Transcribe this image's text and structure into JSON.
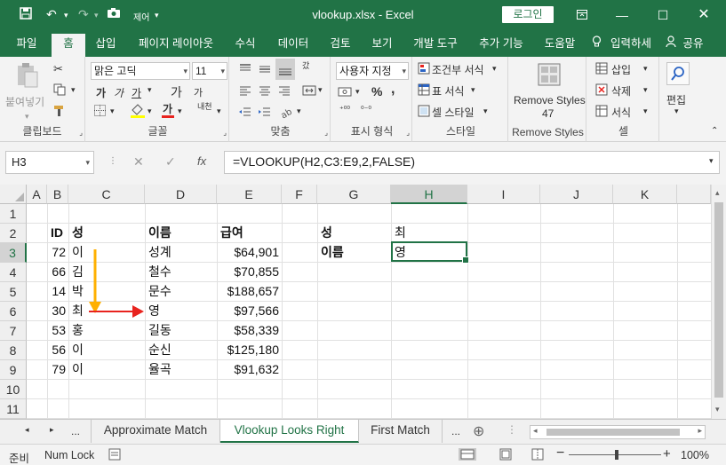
{
  "window": {
    "title": "vlookup.xlsx  -  Excel",
    "login_label": "로그인",
    "autosave_label": "제어"
  },
  "ribbon_tabs": [
    "파일",
    "홈",
    "삽입",
    "페이지 레이아웃",
    "수식",
    "데이터",
    "검토",
    "보기",
    "개발 도구",
    "추가 기능",
    "도움말",
    "입력하세",
    "공유"
  ],
  "ribbon": {
    "clipboard": {
      "paste": "붙여넣기",
      "label": "클립보드"
    },
    "font": {
      "name": "맑은 고딕",
      "size": "11",
      "bold": "가",
      "italic": "가",
      "underline": "가",
      "grow": "가",
      "shrink": "가",
      "label": "글꼴",
      "wrap": "내천"
    },
    "alignment": {
      "label": "맞춤",
      "wrap_text": "갔"
    },
    "number": {
      "format": "사용자 지정",
      "percent": "%",
      "comma": ",",
      "label": "표시 형식"
    },
    "styles": {
      "conditional": "조건부 서식",
      "table": "표 서식",
      "cell": "셀 스타일",
      "label": "스타일"
    },
    "remove_styles": {
      "title": "Remove Styles",
      "count": "47",
      "label": "Remove Styles"
    },
    "cells": {
      "insert": "삽입",
      "delete": "삭제",
      "format": "서식",
      "label": "셀"
    },
    "editing": {
      "label": "편집"
    }
  },
  "formula_bar": {
    "name_box": "H3",
    "fx": "fx",
    "formula": "=VLOOKUP(H2,C3:E9,2,FALSE)"
  },
  "columns": [
    "A",
    "B",
    "C",
    "D",
    "E",
    "F",
    "G",
    "H",
    "I",
    "J",
    "K"
  ],
  "rows": [
    "1",
    "2",
    "3",
    "4",
    "5",
    "6",
    "7",
    "8",
    "9",
    "10",
    "11"
  ],
  "table": {
    "headers": {
      "id": "ID",
      "surname": "성",
      "name": "이름",
      "salary": "급여"
    },
    "rows": [
      {
        "id": "72",
        "surname": "이",
        "name": "성계",
        "salary": "$64,901"
      },
      {
        "id": "66",
        "surname": "김",
        "name": "철수",
        "salary": "$70,855"
      },
      {
        "id": "14",
        "surname": "박",
        "name": "문수",
        "salary": "$188,657"
      },
      {
        "id": "30",
        "surname": "최",
        "name": "영",
        "salary": "$97,566"
      },
      {
        "id": "53",
        "surname": "홍",
        "name": "길동",
        "salary": "$58,339"
      },
      {
        "id": "56",
        "surname": "이",
        "name": "순신",
        "salary": "$125,180"
      },
      {
        "id": "79",
        "surname": "이",
        "name": "율곡",
        "salary": "$91,632"
      }
    ]
  },
  "lookup": {
    "label_surname": "성",
    "value_surname": "최",
    "label_name": "이름",
    "value_name": "영"
  },
  "arrow_colors": {
    "down": "#ffb000",
    "right": "#e8231e"
  },
  "sheet_tabs": [
    "Approximate Match",
    "Vlookup Looks Right",
    "First Match"
  ],
  "sheet_nav_more": "...",
  "status": {
    "ready": "준비",
    "num_lock": "Num Lock",
    "zoom": "100%"
  },
  "accent_color": "#217346"
}
